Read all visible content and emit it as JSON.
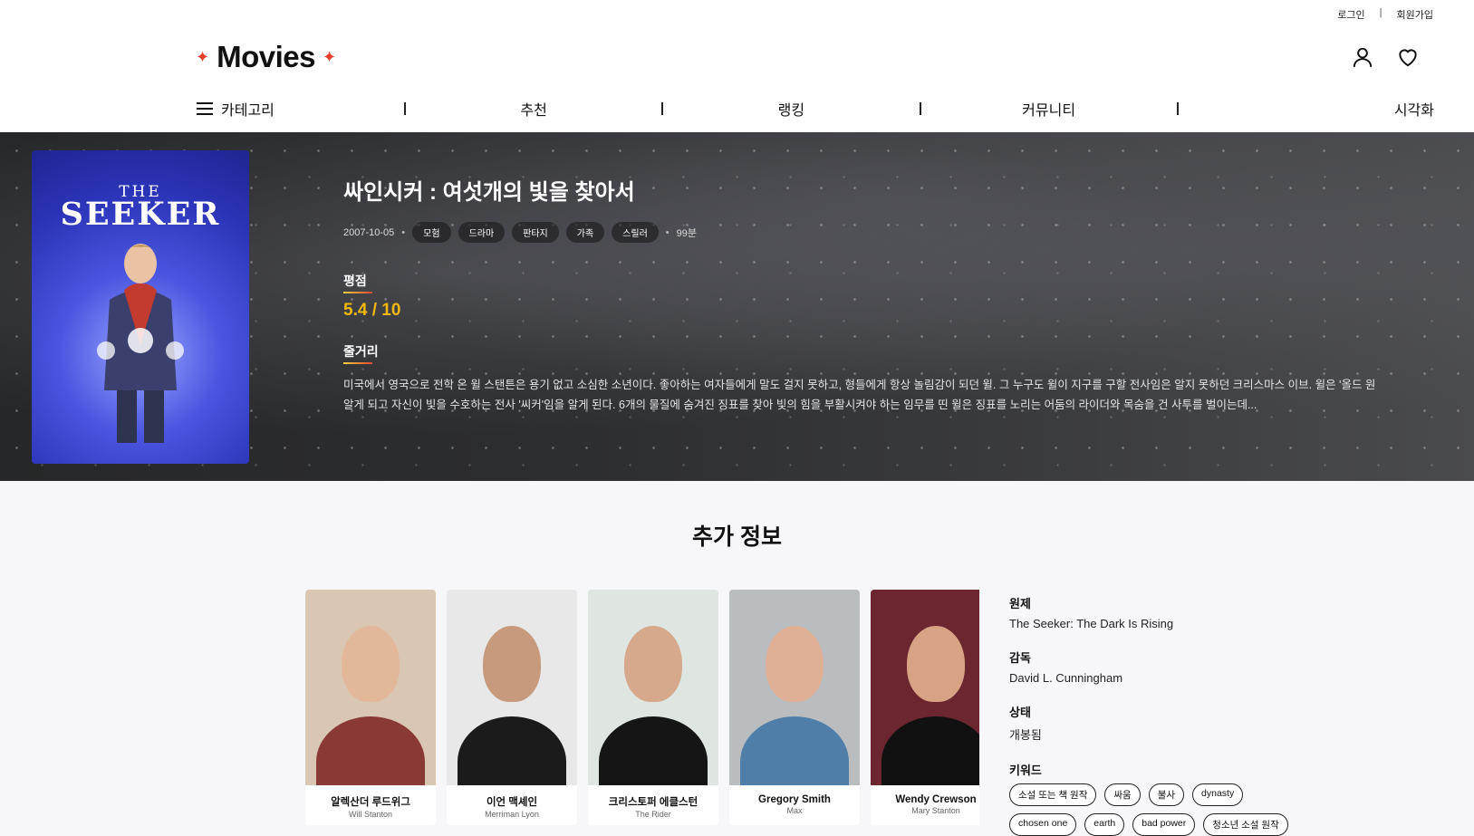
{
  "auth": {
    "login": "로그인",
    "signup": "회원가입"
  },
  "brand": {
    "name": "Movies",
    "spark": "✦",
    "accent": "#e8402b"
  },
  "icons": {
    "user": "user-icon",
    "heart": "heart-icon",
    "menu": "hamburger-icon"
  },
  "nav": {
    "category": "카테고리",
    "recommend": "추천",
    "ranking": "랭킹",
    "community": "커뮤니티",
    "visualization": "시각화"
  },
  "movie": {
    "title": "싸인시커 : 여섯개의 빛을 찾아서",
    "release": "2007-10-05",
    "genres": [
      "모험",
      "드라마",
      "판타지",
      "가족",
      "스릴러"
    ],
    "runtime": "99분",
    "rating_label": "평점",
    "rating": "5.4 / 10",
    "plot_label": "줄거리",
    "plot_line1": "미국에서 영국으로 전학 온 윌 스탠튼은 용기 없고 소심한 소년이다. 좋아하는 여자들에게 말도 걸지 못하고, 형들에게 항상 놀림감이 되던 윌. 그 누구도 윌이 지구를 구할 전사임은 알지 못하던 크리스마스 이브. 윌은 '올드 원",
    "plot_line2": "알게 되고 자신이 빛을 수호하는 전사 '씨커'임을 알게 된다. 6개의 물질에 숨겨진 징표를 찾아 빛의 힘을 부활시켜야 하는 임무를 띤 윌은 징표를 노리는 어둠의 라이더와 목숨을 건 사투를 벌이는데...",
    "poster_title_top": "THE",
    "poster_title_main": "SEEKER"
  },
  "extra": {
    "heading": "추가 정보",
    "original_title_label": "원제",
    "original_title": "The Seeker: The Dark Is Rising",
    "director_label": "감독",
    "director": "David L. Cunningham",
    "status_label": "상태",
    "status": "개봉됨",
    "keywords_label": "키워드",
    "keywords": [
      "소설 또는 책 원작",
      "싸움",
      "불사",
      "dynasty",
      "chosen one",
      "earth",
      "bad power",
      "청소년 소설 원작"
    ]
  },
  "cast": [
    {
      "name": "알렉산더 루드위그",
      "role": "Will Stanton"
    },
    {
      "name": "이언 맥셰인",
      "role": "Merriman Lyon"
    },
    {
      "name": "크리스토퍼 에클스턴",
      "role": "The Rider"
    },
    {
      "name": "Gregory Smith",
      "role": "Max"
    },
    {
      "name": "Wendy Crewson",
      "role": "Mary Stanton"
    }
  ]
}
